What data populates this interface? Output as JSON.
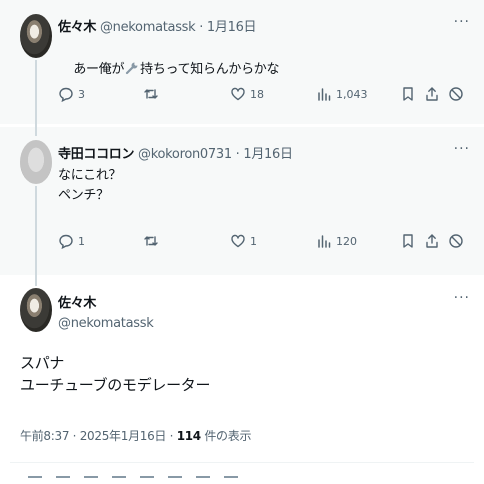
{
  "tweets": [
    {
      "name": "佐々木",
      "handle": "@nekomatassk",
      "dot": "·",
      "date": "1月16日",
      "text_before": "あー俺が",
      "inline_icon": "wrench-icon",
      "text_after": "持ちって知らんからかな",
      "replies": "3",
      "retweets": "",
      "likes": "18",
      "views": "1,043"
    },
    {
      "name": "寺田ココロン",
      "handle": "@kokoron0731",
      "dot": "·",
      "date": "1月16日",
      "text": "なにこれ？\nペンチ？",
      "replies": "1",
      "retweets": "",
      "likes": "1",
      "views": "120"
    }
  ],
  "main_tweet": {
    "name": "佐々木",
    "handle": "@nekomatassk",
    "text": "スパナ\nユーチューブのモデレーター",
    "time": "午前8:37 · 2025年1月16日 · ",
    "views_count": "114",
    "views_label": " 件の表示"
  },
  "more_label": "···",
  "colors": {
    "icon_gray": "#536471",
    "shaded_bg": "#f7f9f9",
    "thread_line": "#cfd9de"
  }
}
